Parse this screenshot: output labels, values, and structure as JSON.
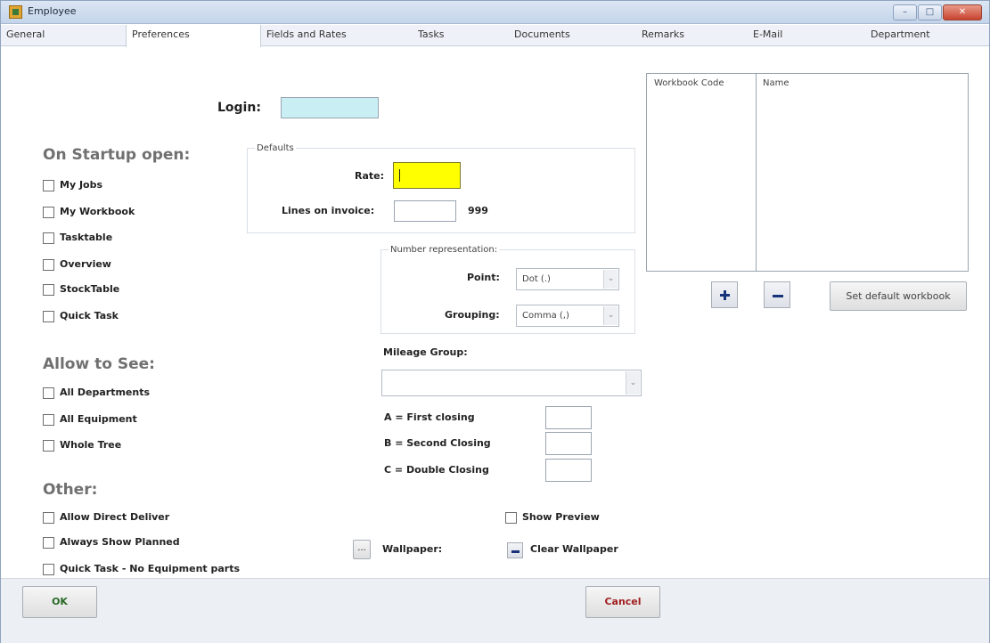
{
  "window": {
    "title": "Employee",
    "min_label": "–",
    "max_label": "□",
    "close_label": "✕"
  },
  "tabs": [
    {
      "label": "General"
    },
    {
      "label": "Preferences"
    },
    {
      "label": "Fields and Rates"
    },
    {
      "label": "Tasks"
    },
    {
      "label": "Documents"
    },
    {
      "label": "Remarks"
    },
    {
      "label": "E-Mail"
    },
    {
      "label": "Department"
    }
  ],
  "login": {
    "label": "Login:",
    "value": ""
  },
  "startup": {
    "title": "On Startup open:",
    "items": [
      {
        "label": "My Jobs",
        "checked": false
      },
      {
        "label": "My Workbook",
        "checked": false
      },
      {
        "label": "Tasktable",
        "checked": false
      },
      {
        "label": "Overview",
        "checked": false
      },
      {
        "label": "StockTable",
        "checked": false
      },
      {
        "label": "Quick Task",
        "checked": false
      }
    ]
  },
  "allow": {
    "title": "Allow to See:",
    "items": [
      {
        "label": "All Departments",
        "checked": false
      },
      {
        "label": "All Equipment",
        "checked": false
      },
      {
        "label": "Whole Tree",
        "checked": false
      }
    ]
  },
  "other": {
    "title": "Other:",
    "items": [
      {
        "label": "Allow Direct Deliver",
        "checked": false
      },
      {
        "label": "Always Show Planned",
        "checked": false
      },
      {
        "label": "Quick Task - No Equipment parts",
        "checked": false
      }
    ]
  },
  "defaults": {
    "legend": "Defaults",
    "rate_label": "Rate:",
    "rate_value": "",
    "lines_label": "Lines on invoice:",
    "lines_value": "",
    "lines_max": "999"
  },
  "number_rep": {
    "legend": "Number representation:",
    "point_label": "Point:",
    "point_value": "Dot (.)",
    "grouping_label": "Grouping:",
    "grouping_value": "Comma (,)"
  },
  "mileage": {
    "label": "Mileage Group:",
    "value": "",
    "a_label": "A = First closing",
    "b_label": "B = Second Closing",
    "c_label": "C = Double Closing"
  },
  "wallpaper": {
    "browse_label": "...",
    "label": "Wallpaper:",
    "show_preview_label": "Show Preview",
    "clear_label": "Clear Wallpaper"
  },
  "workbook_table": {
    "col_code": "Workbook Code",
    "col_name": "Name",
    "set_default_label": "Set default workbook"
  },
  "footer": {
    "ok_label": "OK",
    "cancel_label": "Cancel"
  },
  "colors": {
    "login_bg": "#c9eef4",
    "rate_bg": "#ffff00",
    "ok_text": "#2a6a28",
    "cancel_text": "#a01f1f",
    "accent_blue": "#17337a"
  }
}
